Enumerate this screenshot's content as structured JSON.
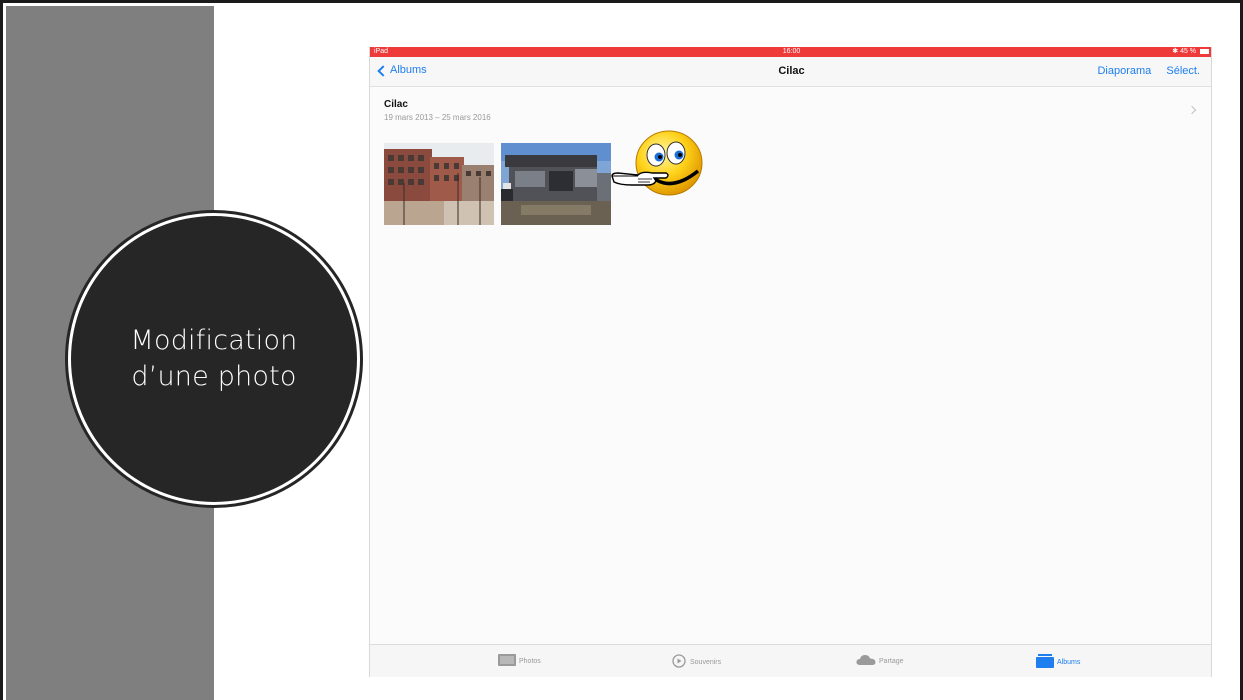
{
  "slide": {
    "title_line1": "Modification",
    "title_line2": "d’une photo"
  },
  "status_bar": {
    "carrier": "iPad",
    "time": "16:00",
    "battery": "45 %"
  },
  "nav": {
    "back_label": "Albums",
    "title": "Cilac",
    "slideshow_label": "Diaporama",
    "select_label": "Sélect."
  },
  "album": {
    "name": "Cilac",
    "dates": "19 mars 2013 – 25 mars 2016"
  },
  "photos": [
    {
      "icon": "photo-thumbnail-brick-buildings"
    },
    {
      "icon": "photo-thumbnail-modern-building"
    }
  ],
  "tab_bar": {
    "tabs": [
      {
        "label": "Photos",
        "icon": "photos-icon",
        "active": false
      },
      {
        "label": "Souvenirs",
        "icon": "memories-icon",
        "active": false
      },
      {
        "label": "Partage",
        "icon": "cloud-icon",
        "active": false
      },
      {
        "label": "Albums",
        "icon": "albums-icon",
        "active": true
      }
    ]
  },
  "colors": {
    "accent": "#1e7ef0",
    "status_bar": "#ef3a3a",
    "circle": "#262626",
    "side_band": "#7f7f7f"
  }
}
